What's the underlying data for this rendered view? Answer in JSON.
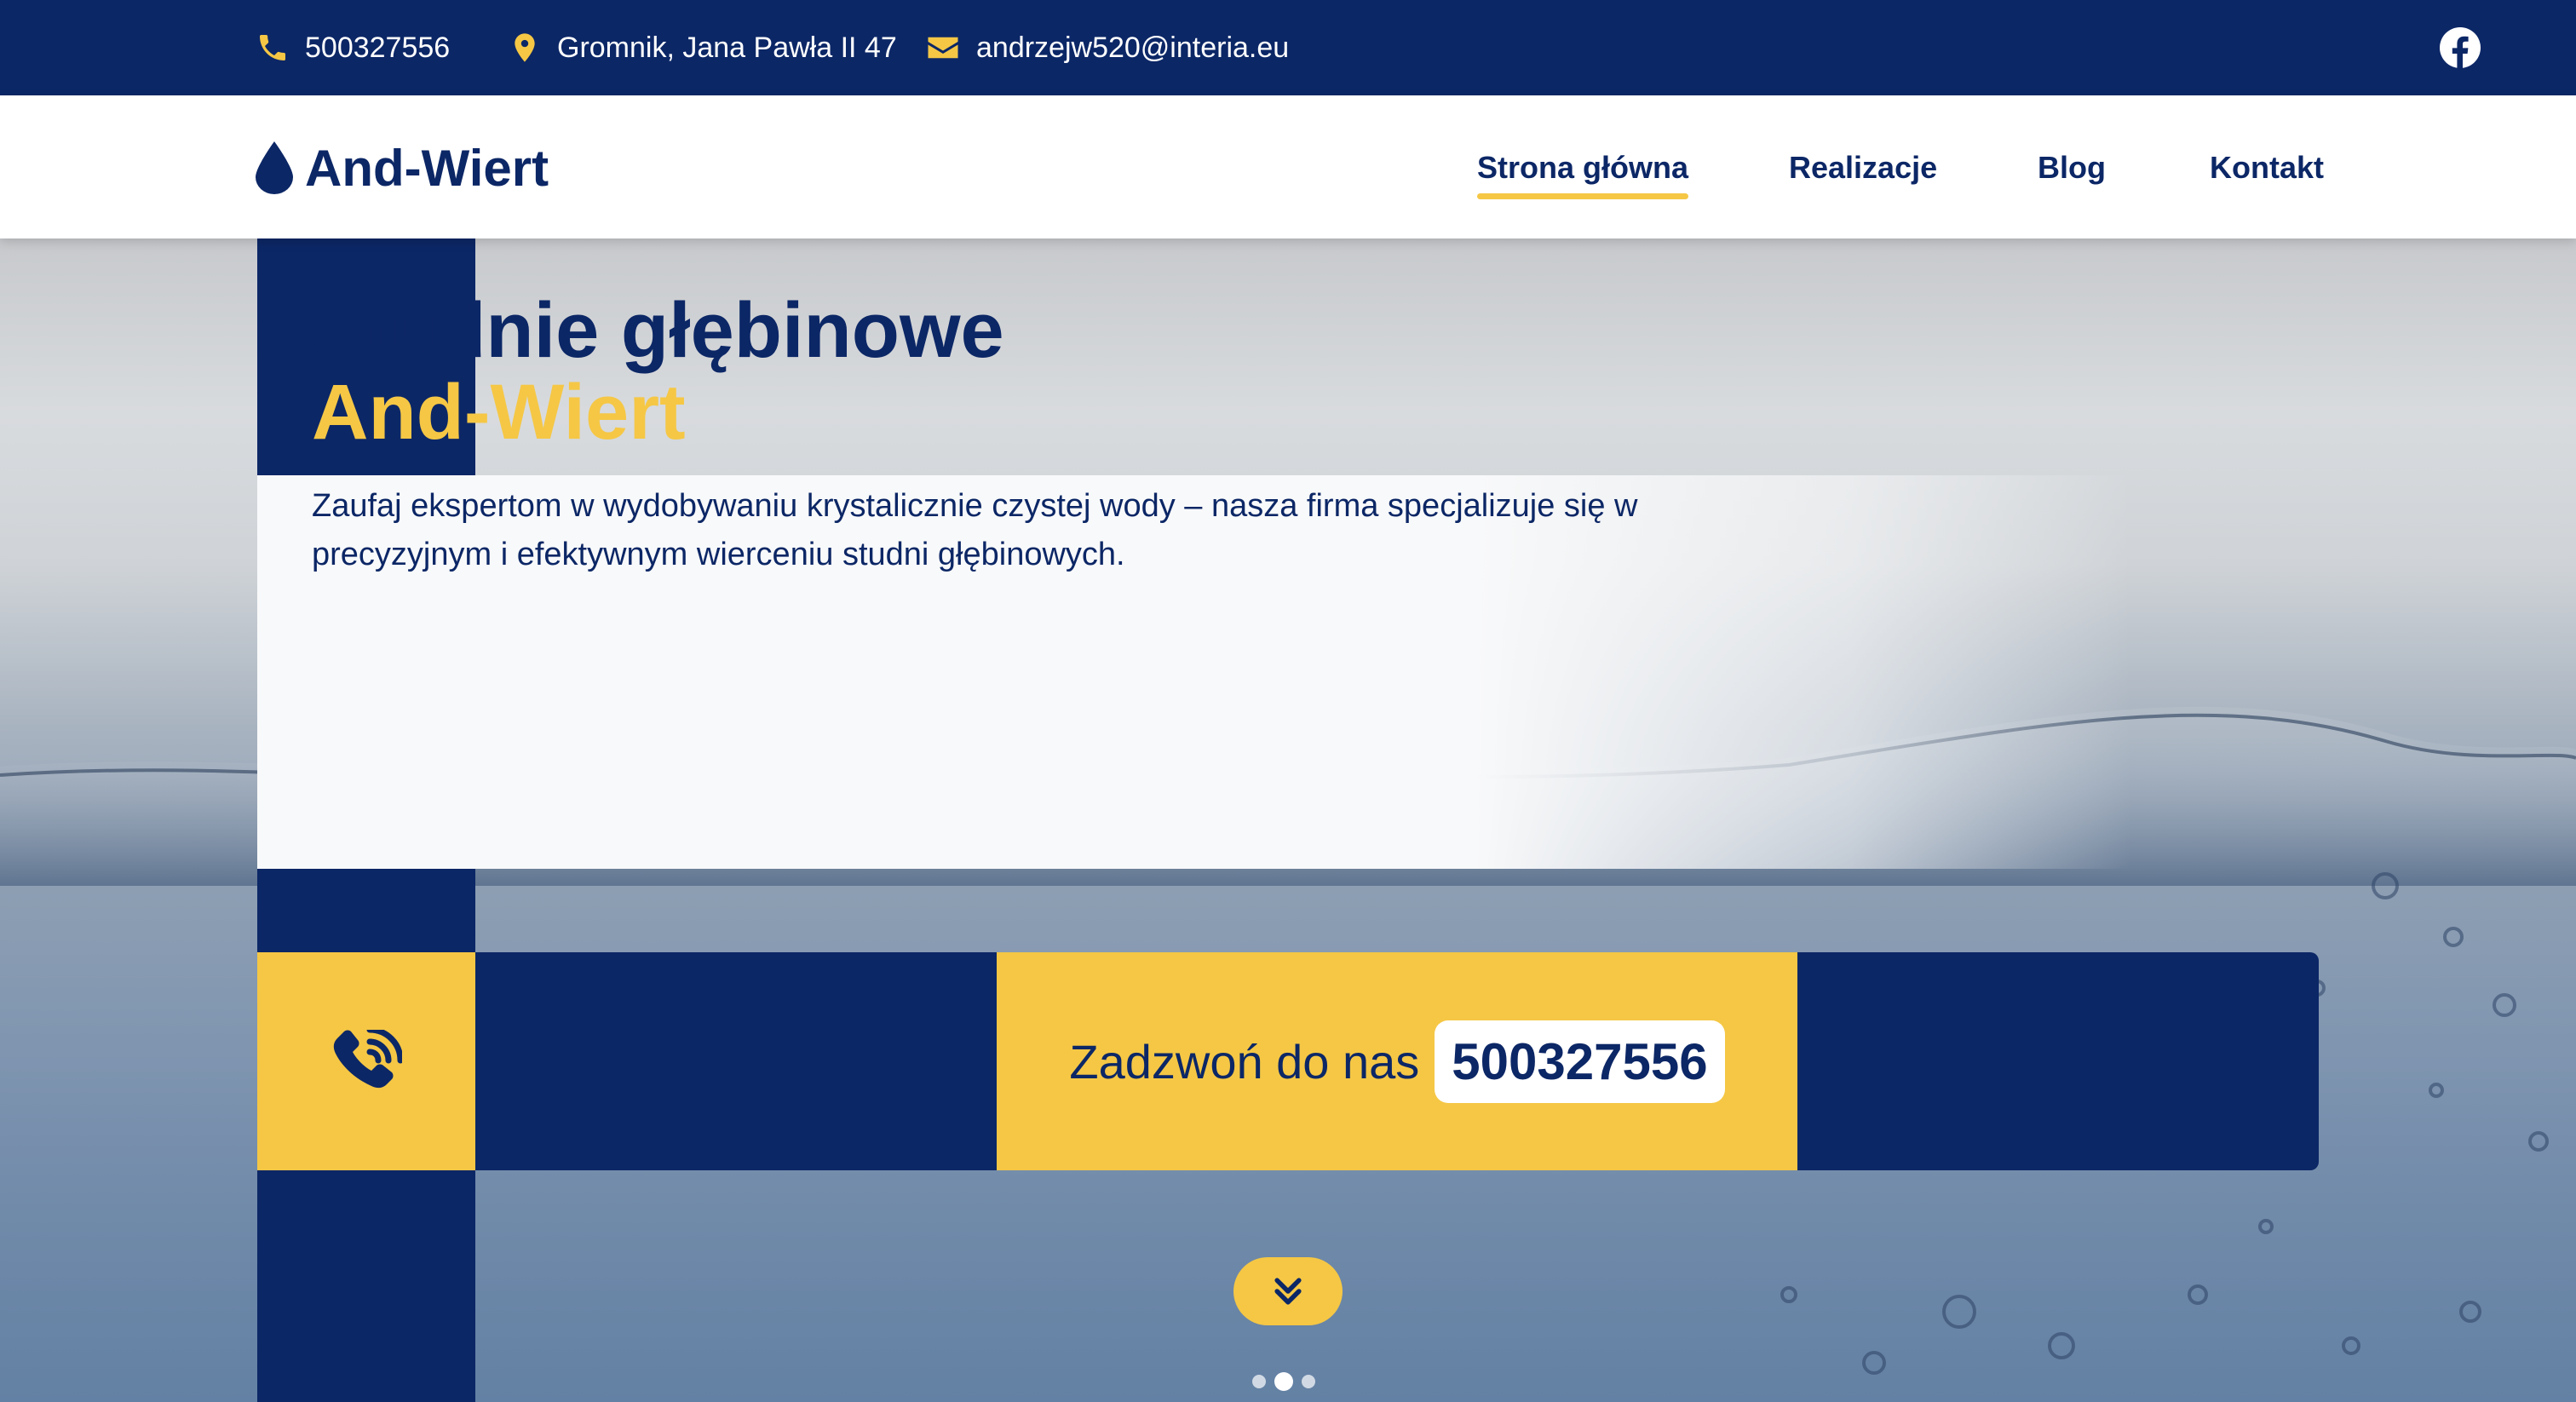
{
  "topbar": {
    "phone": "500327556",
    "address": "Gromnik, Jana Pawła II 47",
    "email": "andrzejw520@interia.eu",
    "social_icon": "facebook-icon"
  },
  "navbar": {
    "logo": "And-Wiert",
    "items": [
      {
        "label": "Strona główna",
        "active": true
      },
      {
        "label": "Realizacje",
        "active": false
      },
      {
        "label": "Blog",
        "active": false
      },
      {
        "label": "Kontakt",
        "active": false
      }
    ]
  },
  "hero": {
    "title_line1": "Studnie głębinowe",
    "title_line2": "And-Wiert",
    "description": "Zaufaj ekspertom w wydobywaniu krystalicznie czystej wody – nasza firma specjalizuje się w precyzyjnym i efektywnym wierceniu studni głębinowych.",
    "cta_label": "Zadzwoń do nas",
    "cta_number": "500327556",
    "slides_count": 3,
    "active_slide": 2
  },
  "colors": {
    "primary": "#0c2766",
    "accent": "#f5c745",
    "white": "#ffffff"
  }
}
